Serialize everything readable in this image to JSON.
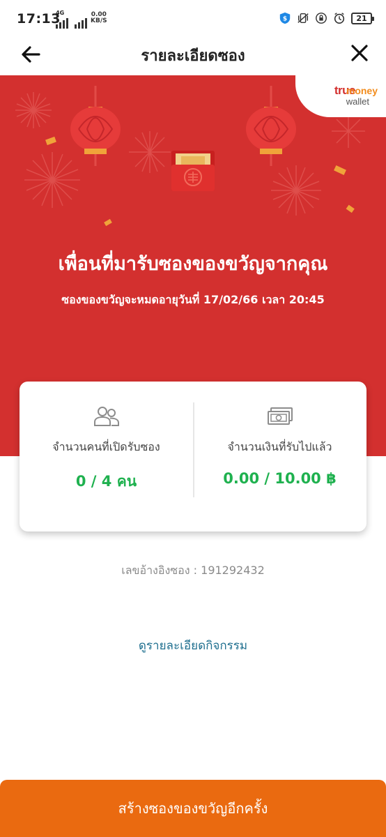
{
  "status_bar": {
    "time": "17:13",
    "network": "4G",
    "speed_value": "0.00",
    "speed_unit": "KB/S",
    "battery": "21",
    "icons": [
      "signal-icon",
      "shield-dollar-icon",
      "vibrate-icon",
      "lock-rotation-icon",
      "alarm-icon",
      "battery-icon"
    ]
  },
  "header": {
    "title": "รายละเอียดซอง",
    "back_icon": "back-arrow-icon",
    "close_icon": "close-icon"
  },
  "brand": {
    "true": "true",
    "money": "money",
    "wallet": "wallet"
  },
  "banner": {
    "title": "เพื่อนที่มารับซองของขวัญจากคุณ",
    "subtitle": "ซองของขวัญจะหมดอายุวันที่ 17/02/66 เวลา 20:45",
    "icon": "red-envelope-icon"
  },
  "stats": {
    "people": {
      "icon": "people-icon",
      "label": "จำนวนคนที่เปิดรับซอง",
      "value": "0 / 4 คน"
    },
    "money": {
      "icon": "banknote-icon",
      "label": "จำนวนเงินที่รับไปแล้ว",
      "value": "0.00 / 10.00 ฿"
    }
  },
  "reference": "เลขอ้างอิงซอง : 191292432",
  "activity_link": "ดูรายละเอียดกิจกรรม",
  "primary_button": "สร้างซองของขวัญอีกครั้ง",
  "colors": {
    "banner_red": "#d3302f",
    "value_green": "#1fb14f",
    "link_teal": "#1f6f8f",
    "button_orange": "#ea6a10",
    "brand_orange": "#f28c1c"
  }
}
